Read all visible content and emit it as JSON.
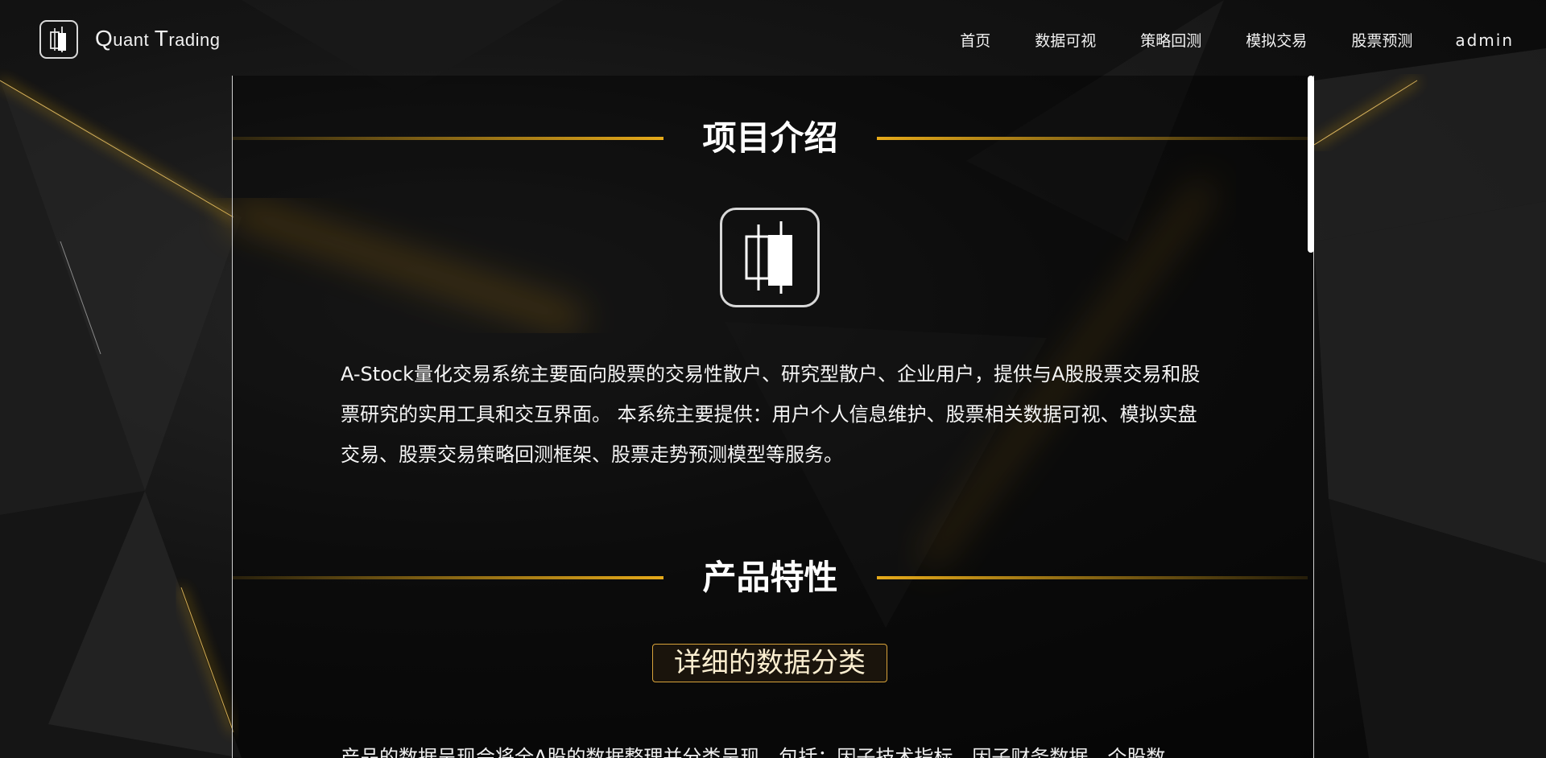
{
  "app": {
    "brand_first_q": "Q",
    "brand_uant": "uant ",
    "brand_first_t": "T",
    "brand_rading": "rading",
    "logo_icon": "candlestick-icon"
  },
  "nav": {
    "items": [
      {
        "label": "首页"
      },
      {
        "label": "数据可视"
      },
      {
        "label": "策略回测"
      },
      {
        "label": "模拟交易"
      },
      {
        "label": "股票预测"
      }
    ],
    "user": "admin"
  },
  "sections": {
    "intro": {
      "title": "项目介绍",
      "icon": "candlestick-icon",
      "body": "A-Stock量化交易系统主要面向股票的交易性散户、研究型散户、企业用户，提供与A股股票交易和股票研究的实用工具和交互界面。 本系统主要提供：用户个人信息维护、股票相关数据可视、模拟实盘交易、股票交易策略回测框架、股票走势预测模型等服务。"
    },
    "features": {
      "title": "产品特性",
      "badge": "详细的数据分类",
      "desc": "产品的数据呈现会将全A股的数据整理并分类呈现，包括：因子技术指标、因子财务数据、个股数"
    }
  },
  "colors": {
    "accent": "#e6aa1a",
    "badge_border": "#d9a33a",
    "background": "#0b0b0b"
  }
}
